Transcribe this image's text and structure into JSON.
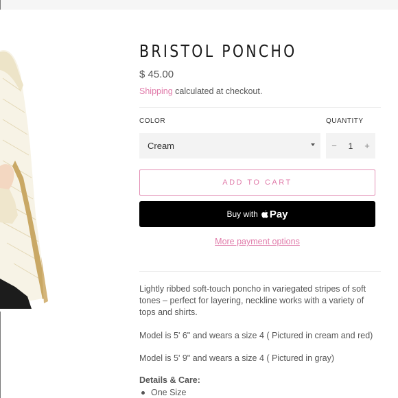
{
  "product": {
    "title": "BRISTOL PONCHO",
    "price": "$ 45.00",
    "shipping_link": "Shipping",
    "shipping_text": " calculated at checkout."
  },
  "options": {
    "color_label": "COLOR",
    "color_value": "Cream",
    "quantity_label": "QUANTITY",
    "quantity_value": "1",
    "minus": "−",
    "plus": "+"
  },
  "actions": {
    "add_to_cart": "ADD TO CART",
    "buy_with": "Buy with",
    "pay_label": "Pay",
    "more_options": "More payment options"
  },
  "description": {
    "paragraph1": "Lightly ribbed soft-touch poncho in variegated stripes of soft tones – perfect for layering, neckline works with a variety of tops and shirts.",
    "paragraph2": "Model is 5' 6\" and wears a size 4 ( Pictured in cream and red)",
    "paragraph3": "Model is 5' 9\" and wears a size 4 ( Pictured in gray)",
    "details_heading": "Details & Care:",
    "details_items": [
      "One Size"
    ]
  },
  "colors": {
    "accent": "#e07aa9",
    "button_dark": "#000000",
    "field_bg": "#f3f3f3"
  },
  "icons": {
    "select_caret": "caret-down-icon",
    "apple": "apple-logo-icon"
  }
}
